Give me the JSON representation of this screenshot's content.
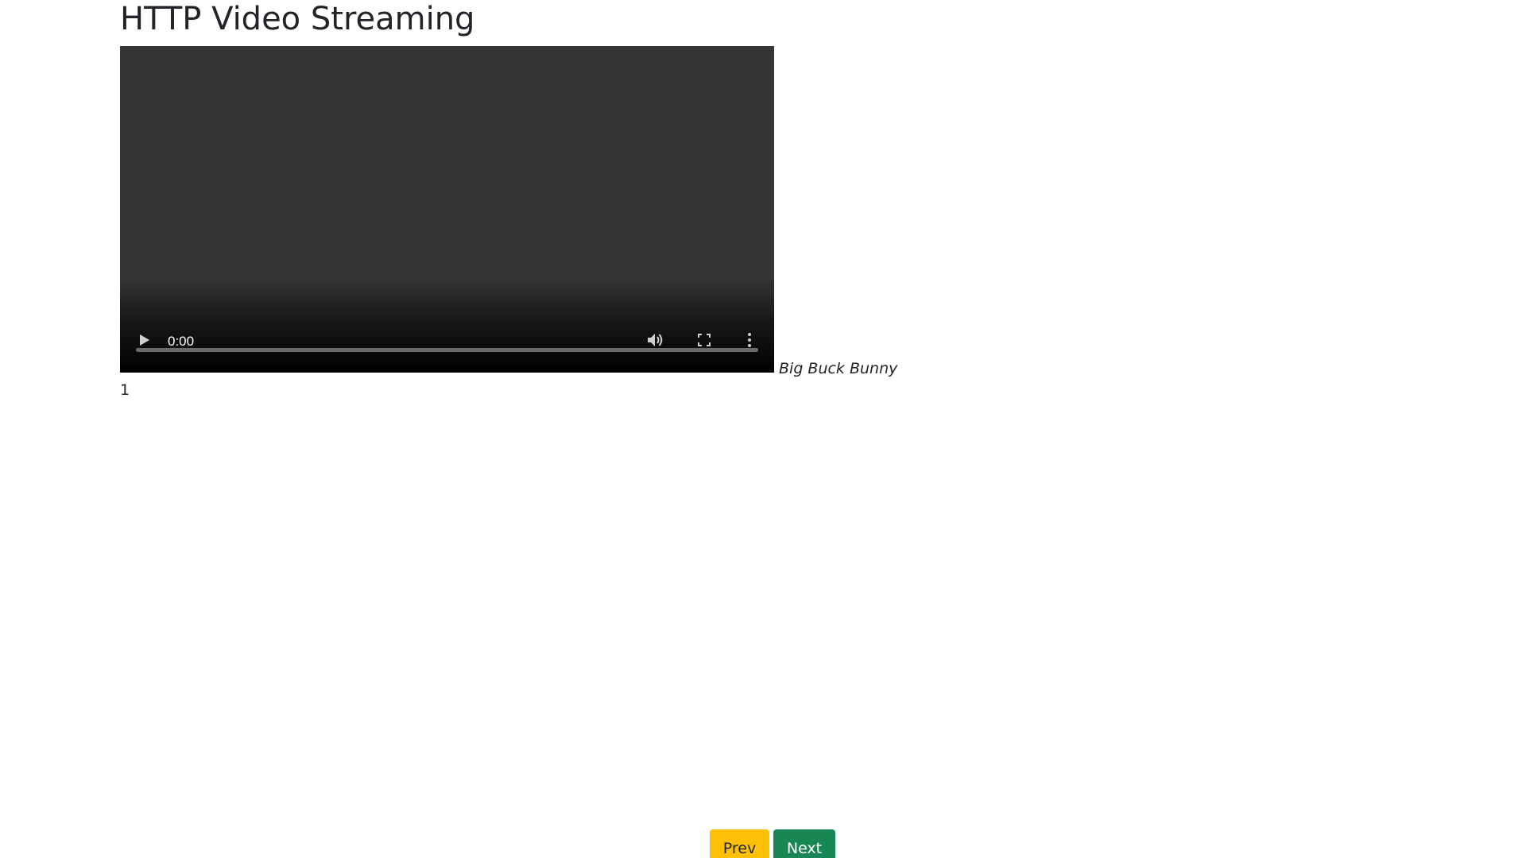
{
  "header": {
    "title": "HTTP Video Streaming"
  },
  "video": {
    "current_time": "0:00",
    "caption": "Big Buck Bunny",
    "progress": 0,
    "icons": {
      "play": "play-icon",
      "volume": "volume-icon",
      "fullscreen": "fullscreen-icon",
      "more": "more-options-icon"
    }
  },
  "pagination": {
    "current_page": "1",
    "prev_label": "Prev",
    "next_label": "Next"
  },
  "colors": {
    "prev_button": "#ffc107",
    "next_button": "#198754",
    "video_background": "#353535"
  }
}
